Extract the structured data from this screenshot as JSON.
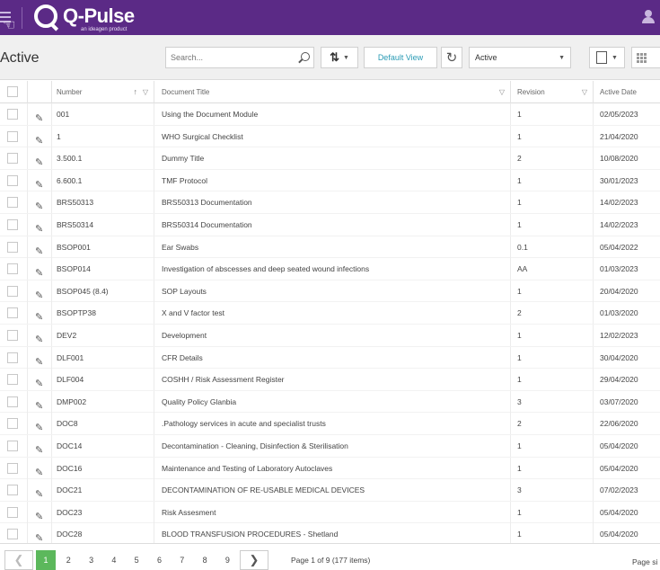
{
  "header": {
    "logo_text": "Q-Pulse",
    "logo_subtitle": "an ideagen product"
  },
  "toolbar": {
    "page_title": "Active",
    "search_placeholder": "Search...",
    "default_view_label": "Default View",
    "status_value": "Active"
  },
  "table": {
    "columns": {
      "number": "Number",
      "title": "Document Title",
      "revision": "Revision",
      "active_date": "Active Date"
    },
    "rows": [
      {
        "number": "001",
        "title": "Using the Document Module",
        "revision": "1",
        "date": "02/05/2023"
      },
      {
        "number": "1",
        "title": "WHO Surgical Checklist",
        "revision": "1",
        "date": "21/04/2020"
      },
      {
        "number": "3.500.1",
        "title": "Dummy Title",
        "revision": "2",
        "date": "10/08/2020"
      },
      {
        "number": "6.600.1",
        "title": "TMF Protocol",
        "revision": "1",
        "date": "30/01/2023"
      },
      {
        "number": "BRS50313",
        "title": "BRS50313 Documentation",
        "revision": "1",
        "date": "14/02/2023"
      },
      {
        "number": "BRS50314",
        "title": "BRS50314 Documentation",
        "revision": "1",
        "date": "14/02/2023"
      },
      {
        "number": "BSOP001",
        "title": "Ear Swabs",
        "revision": "0.1",
        "date": "05/04/2022"
      },
      {
        "number": "BSOP014",
        "title": "Investigation of abscesses and deep seated wound infections",
        "revision": "AA",
        "date": "01/03/2023"
      },
      {
        "number": "BSOP045 (8.4)",
        "title": "SOP Layouts",
        "revision": "1",
        "date": "20/04/2020"
      },
      {
        "number": "BSOPTP38",
        "title": "X and V factor test",
        "revision": "2",
        "date": "01/03/2020"
      },
      {
        "number": "DEV2",
        "title": "Development",
        "revision": "1",
        "date": "12/02/2023"
      },
      {
        "number": "DLF001",
        "title": "CFR Details",
        "revision": "1",
        "date": "30/04/2020"
      },
      {
        "number": "DLF004",
        "title": "COSHH / Risk Assessment Register",
        "revision": "1",
        "date": "29/04/2020"
      },
      {
        "number": "DMP002",
        "title": "Quality Policy Glanbia",
        "revision": "3",
        "date": "03/07/2020"
      },
      {
        "number": "DOC8",
        "title": ".Pathology services in acute and specialist trusts",
        "revision": "2",
        "date": "22/06/2020"
      },
      {
        "number": "DOC14",
        "title": "Decontamination - Cleaning, Disinfection & Sterilisation",
        "revision": "1",
        "date": "05/04/2020"
      },
      {
        "number": "DOC16",
        "title": "Maintenance and Testing of Laboratory Autoclaves",
        "revision": "1",
        "date": "05/04/2020"
      },
      {
        "number": "DOC21",
        "title": "DECONTAMINATION OF RE-USABLE MEDICAL DEVICES",
        "revision": "3",
        "date": "07/02/2023"
      },
      {
        "number": "DOC23",
        "title": "Risk Assesment",
        "revision": "1",
        "date": "05/04/2020"
      },
      {
        "number": "DOC28",
        "title": "BLOOD TRANSFUSION PROCEDURES - Shetland",
        "revision": "1",
        "date": "05/04/2020"
      }
    ]
  },
  "pagination": {
    "pages": [
      "1",
      "2",
      "3",
      "4",
      "5",
      "6",
      "7",
      "8",
      "9"
    ],
    "current": "1",
    "info": "Page 1 of 9 (177 items)",
    "page_size_label": "Page si"
  }
}
